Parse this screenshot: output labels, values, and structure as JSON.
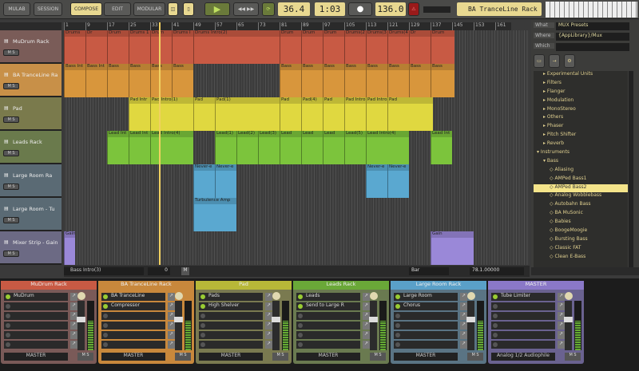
{
  "toolbar": {
    "mulab": "MULAB",
    "session": "SESSION",
    "compose": "COMPOSE",
    "edit": "EDIT",
    "modular": "MODULAR",
    "position": "36.4",
    "time": "1:03",
    "tempo": "136.0",
    "focus_rack": "BA TranceLine Rack",
    "accent": "#e8d890"
  },
  "ruler": {
    "bars": [
      "1",
      "9",
      "17",
      "25",
      "33",
      "41",
      "49",
      "57",
      "65",
      "73",
      "81",
      "89",
      "97",
      "105",
      "113",
      "121",
      "129",
      "137",
      "145",
      "153",
      "161"
    ],
    "playhead_bar": 36.4
  },
  "tracks": [
    {
      "name": "MuDrum Rack",
      "color": "#c85a44",
      "clips": [
        [
          1,
          9,
          "Drums"
        ],
        [
          9,
          17,
          "Dr"
        ],
        [
          17,
          25,
          "Drum"
        ],
        [
          25,
          33,
          "Drums 1"
        ],
        [
          33,
          41,
          "Drum"
        ],
        [
          41,
          49,
          "Drums I"
        ],
        [
          49,
          81,
          "Drums Intro(2)"
        ],
        [
          81,
          89,
          "Drum"
        ],
        [
          89,
          97,
          "Drum"
        ],
        [
          97,
          105,
          "Drum"
        ],
        [
          105,
          113,
          "Drums(2"
        ],
        [
          113,
          121,
          "Drums(3"
        ],
        [
          121,
          129,
          "Drums(4"
        ],
        [
          129,
          137,
          "Dr"
        ],
        [
          137,
          146,
          "Drum"
        ]
      ]
    },
    {
      "name": "BA TranceLine Ra",
      "color": "#d8963c",
      "clips": [
        [
          1,
          9,
          "Bass Int"
        ],
        [
          9,
          17,
          "Bass Int"
        ],
        [
          17,
          25,
          "Bass"
        ],
        [
          25,
          33,
          "Bass"
        ],
        [
          33,
          41,
          "Bass"
        ],
        [
          41,
          49,
          "Bass"
        ],
        [
          81,
          89,
          "Bass"
        ],
        [
          89,
          97,
          "Bass"
        ],
        [
          97,
          105,
          "Bass"
        ],
        [
          105,
          113,
          "Bass"
        ],
        [
          113,
          121,
          "Bass"
        ],
        [
          121,
          129,
          "Bass"
        ],
        [
          129,
          137,
          "Bass"
        ],
        [
          137,
          146,
          "Bass"
        ]
      ]
    },
    {
      "name": "Pad",
      "color": "#e0d840",
      "clips": [
        [
          25,
          33,
          "Pad Intr"
        ],
        [
          33,
          49,
          "Pad Intro(1)"
        ],
        [
          49,
          57,
          "Pad"
        ],
        [
          57,
          81,
          "Pad(1)"
        ],
        [
          81,
          89,
          "Pad"
        ],
        [
          89,
          97,
          "Pad(4)"
        ],
        [
          97,
          105,
          "Pad"
        ],
        [
          105,
          113,
          "Pad Intro(1)"
        ],
        [
          113,
          121,
          "Pad Intro(1)"
        ],
        [
          121,
          138,
          "Pad"
        ]
      ]
    },
    {
      "name": "Leads Rack",
      "color": "#7cc43c",
      "clips": [
        [
          17,
          25,
          "Lead Int"
        ],
        [
          25,
          33,
          "Lead Int"
        ],
        [
          33,
          49,
          "Lead Intro(4)"
        ],
        [
          57,
          65,
          "Lead(1)"
        ],
        [
          65,
          73,
          "Lead(2)"
        ],
        [
          73,
          81,
          "Lead(3)"
        ],
        [
          81,
          89,
          "Lead"
        ],
        [
          89,
          97,
          "Lead"
        ],
        [
          97,
          105,
          "Lead"
        ],
        [
          105,
          113,
          "Lead(5)"
        ],
        [
          113,
          129,
          "Lead Intro(4)"
        ],
        [
          137,
          145,
          "Lead Int"
        ]
      ]
    },
    {
      "name": "Large Room Ra",
      "color": "#5aa8d0",
      "clips": [
        [
          49,
          57,
          "Never-e"
        ],
        [
          57,
          65,
          "Never-e"
        ],
        [
          113,
          121,
          "Never-e"
        ],
        [
          121,
          129,
          "Never-e"
        ]
      ]
    },
    {
      "name": "Large Room - Tu",
      "color": "#5aa8d0",
      "clips": [
        [
          49,
          65,
          "Turbulence Amp"
        ]
      ]
    },
    {
      "name": "Mixer Strip - Gain",
      "color": "#9a88d8",
      "clips": [
        [
          1,
          5,
          "Gain"
        ],
        [
          137,
          153,
          "Gain"
        ]
      ]
    }
  ],
  "track_colors_bg": [
    "#7a5c58",
    "#c89048",
    "#7a7a4c",
    "#6a7a4c",
    "#5a6a74",
    "#5a6a74",
    "#6c6a84"
  ],
  "ms_label": "M S",
  "clipbar": {
    "clip_name": "Bass Intro(3)",
    "value": "0",
    "m": "M",
    "unit": "Bar",
    "position": "78.1.00000"
  },
  "browser": {
    "what_label": "What",
    "what": "MUX Presets",
    "where_label": "Where",
    "where": "{AppLibrary}/Mux",
    "which_label": "Which",
    "which": "",
    "items": [
      [
        "Experimental Units",
        1
      ],
      [
        "Filters",
        1
      ],
      [
        "Flanger",
        1
      ],
      [
        "Modulation",
        1
      ],
      [
        "MonoStereo",
        1
      ],
      [
        "Others",
        1
      ],
      [
        "Phaser",
        1
      ],
      [
        "Pitch Shifter",
        1
      ],
      [
        "Reverb",
        1
      ],
      [
        "Instruments",
        0
      ],
      [
        "Bass",
        1
      ],
      [
        "Aliasing",
        2
      ],
      [
        "AMPed Bass1",
        2
      ],
      [
        "AMPed Bass2",
        2
      ],
      [
        "Analog Wobblebass",
        2
      ],
      [
        "Autobahn Bass",
        2
      ],
      [
        "BA MuSonic",
        2
      ],
      [
        "Babies",
        2
      ],
      [
        "BoogeMoogie",
        2
      ],
      [
        "Bursting Bass",
        2
      ],
      [
        "Classic FAT",
        2
      ],
      [
        "Clean E-Bass",
        2
      ]
    ],
    "selected": "AMPed Bass2"
  },
  "mixer": [
    {
      "title": "MuDrum Rack",
      "color": "#c85a44",
      "bg": "#7a5a58",
      "slots": [
        "MuDrum"
      ],
      "out": "MASTER"
    },
    {
      "title": "BA TranceLine Rack",
      "color": "#c8883c",
      "bg": "#c8883c",
      "slots": [
        "BA TranceLine",
        "Compressor"
      ],
      "out": "MASTER"
    },
    {
      "title": "Pad",
      "color": "#b8b838",
      "bg": "#7a7a50",
      "slots": [
        "Pads",
        "High Shelver"
      ],
      "out": "MASTER"
    },
    {
      "title": "Leads Rack",
      "color": "#6aa838",
      "bg": "#6a7a50",
      "slots": [
        "Leads",
        "Send to Large R"
      ],
      "out": "MASTER"
    },
    {
      "title": "Large Room Rack",
      "color": "#5aa0c8",
      "bg": "#5a7484",
      "slots": [
        "Large Room",
        "Chorus"
      ],
      "out": "MASTER"
    },
    {
      "title": "MASTER",
      "color": "#8a78c8",
      "bg": "#6a6290",
      "slots": [
        "Tube Limiter"
      ],
      "out": "Analog 1/2 Audiophile"
    }
  ]
}
